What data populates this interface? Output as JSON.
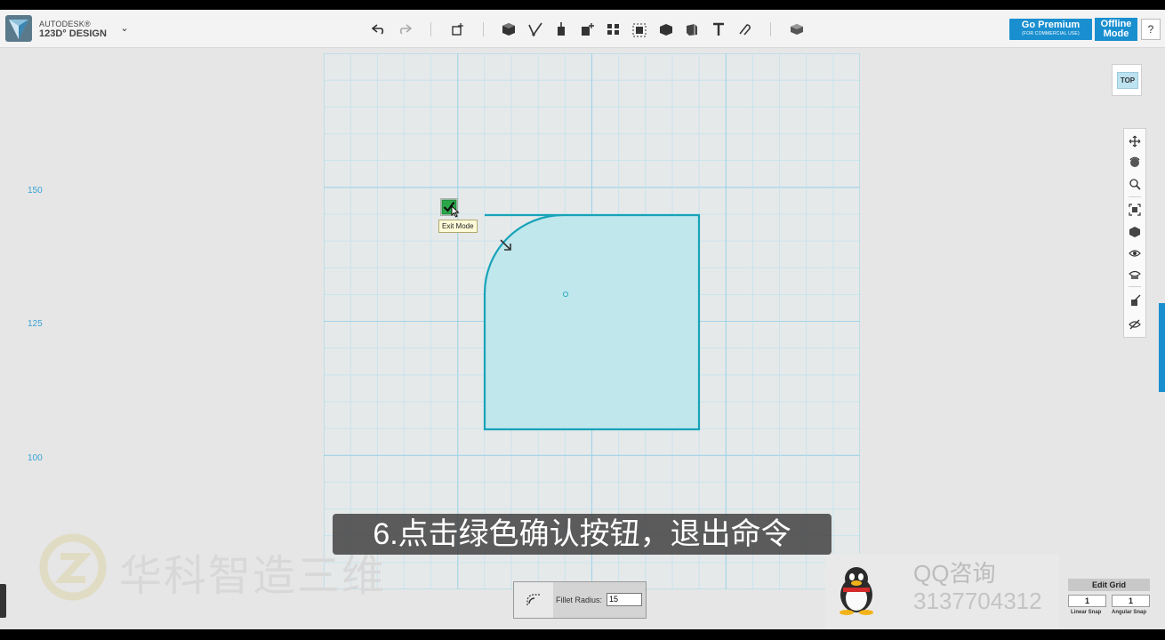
{
  "app": {
    "brand_line1": "AUTODESK®",
    "brand_line2": "123D° DESIGN",
    "brand_menu_icon": "chevron-down-icon"
  },
  "toolbar": {
    "tools": [
      {
        "name": "undo-icon",
        "group": "history"
      },
      {
        "name": "redo-icon",
        "group": "history"
      },
      {
        "name": "transform-icon",
        "group": "transform"
      },
      {
        "name": "primitives-icon",
        "group": "create"
      },
      {
        "name": "sketch-icon",
        "group": "create"
      },
      {
        "name": "construct-icon",
        "group": "create"
      },
      {
        "name": "modify-icon",
        "group": "create"
      },
      {
        "name": "pattern-icon",
        "group": "create"
      },
      {
        "name": "grouping-icon",
        "group": "create"
      },
      {
        "name": "combine-icon",
        "group": "create"
      },
      {
        "name": "measure-icon",
        "group": "create"
      },
      {
        "name": "text-icon",
        "group": "create"
      },
      {
        "name": "snap-icon",
        "group": "create"
      },
      {
        "name": "materials-icon",
        "group": "material"
      }
    ]
  },
  "premium": {
    "title": "Go Premium",
    "subtitle": "(FOR COMMERCIAL USE)"
  },
  "offline": {
    "line1": "Offline",
    "line2": "Mode"
  },
  "help_label": "?",
  "viewcube_label": "TOP",
  "axis_labels": [
    "150",
    "125",
    "100"
  ],
  "exit_mode": {
    "tooltip": "Exit Mode"
  },
  "subtitle_text": "6.点击绿色确认按钮，退出命令",
  "watermark_text": "华科智造三维",
  "qq": {
    "title": "QQ咨询",
    "number": "3137704312"
  },
  "fillet": {
    "label": "Fillet Radius:",
    "value": "15"
  },
  "edit_grid": {
    "title": "Edit Grid",
    "linear_value": "1",
    "angular_value": "1",
    "linear_label": "Linear Snap",
    "angular_label": "Angular Snap"
  },
  "colors": {
    "accent": "#1a8fd0",
    "grid": "#a8d8ea",
    "shape_fill": "#bfe7ec",
    "shape_stroke": "#17a3b8",
    "axis_label": "#3aa3d6"
  }
}
